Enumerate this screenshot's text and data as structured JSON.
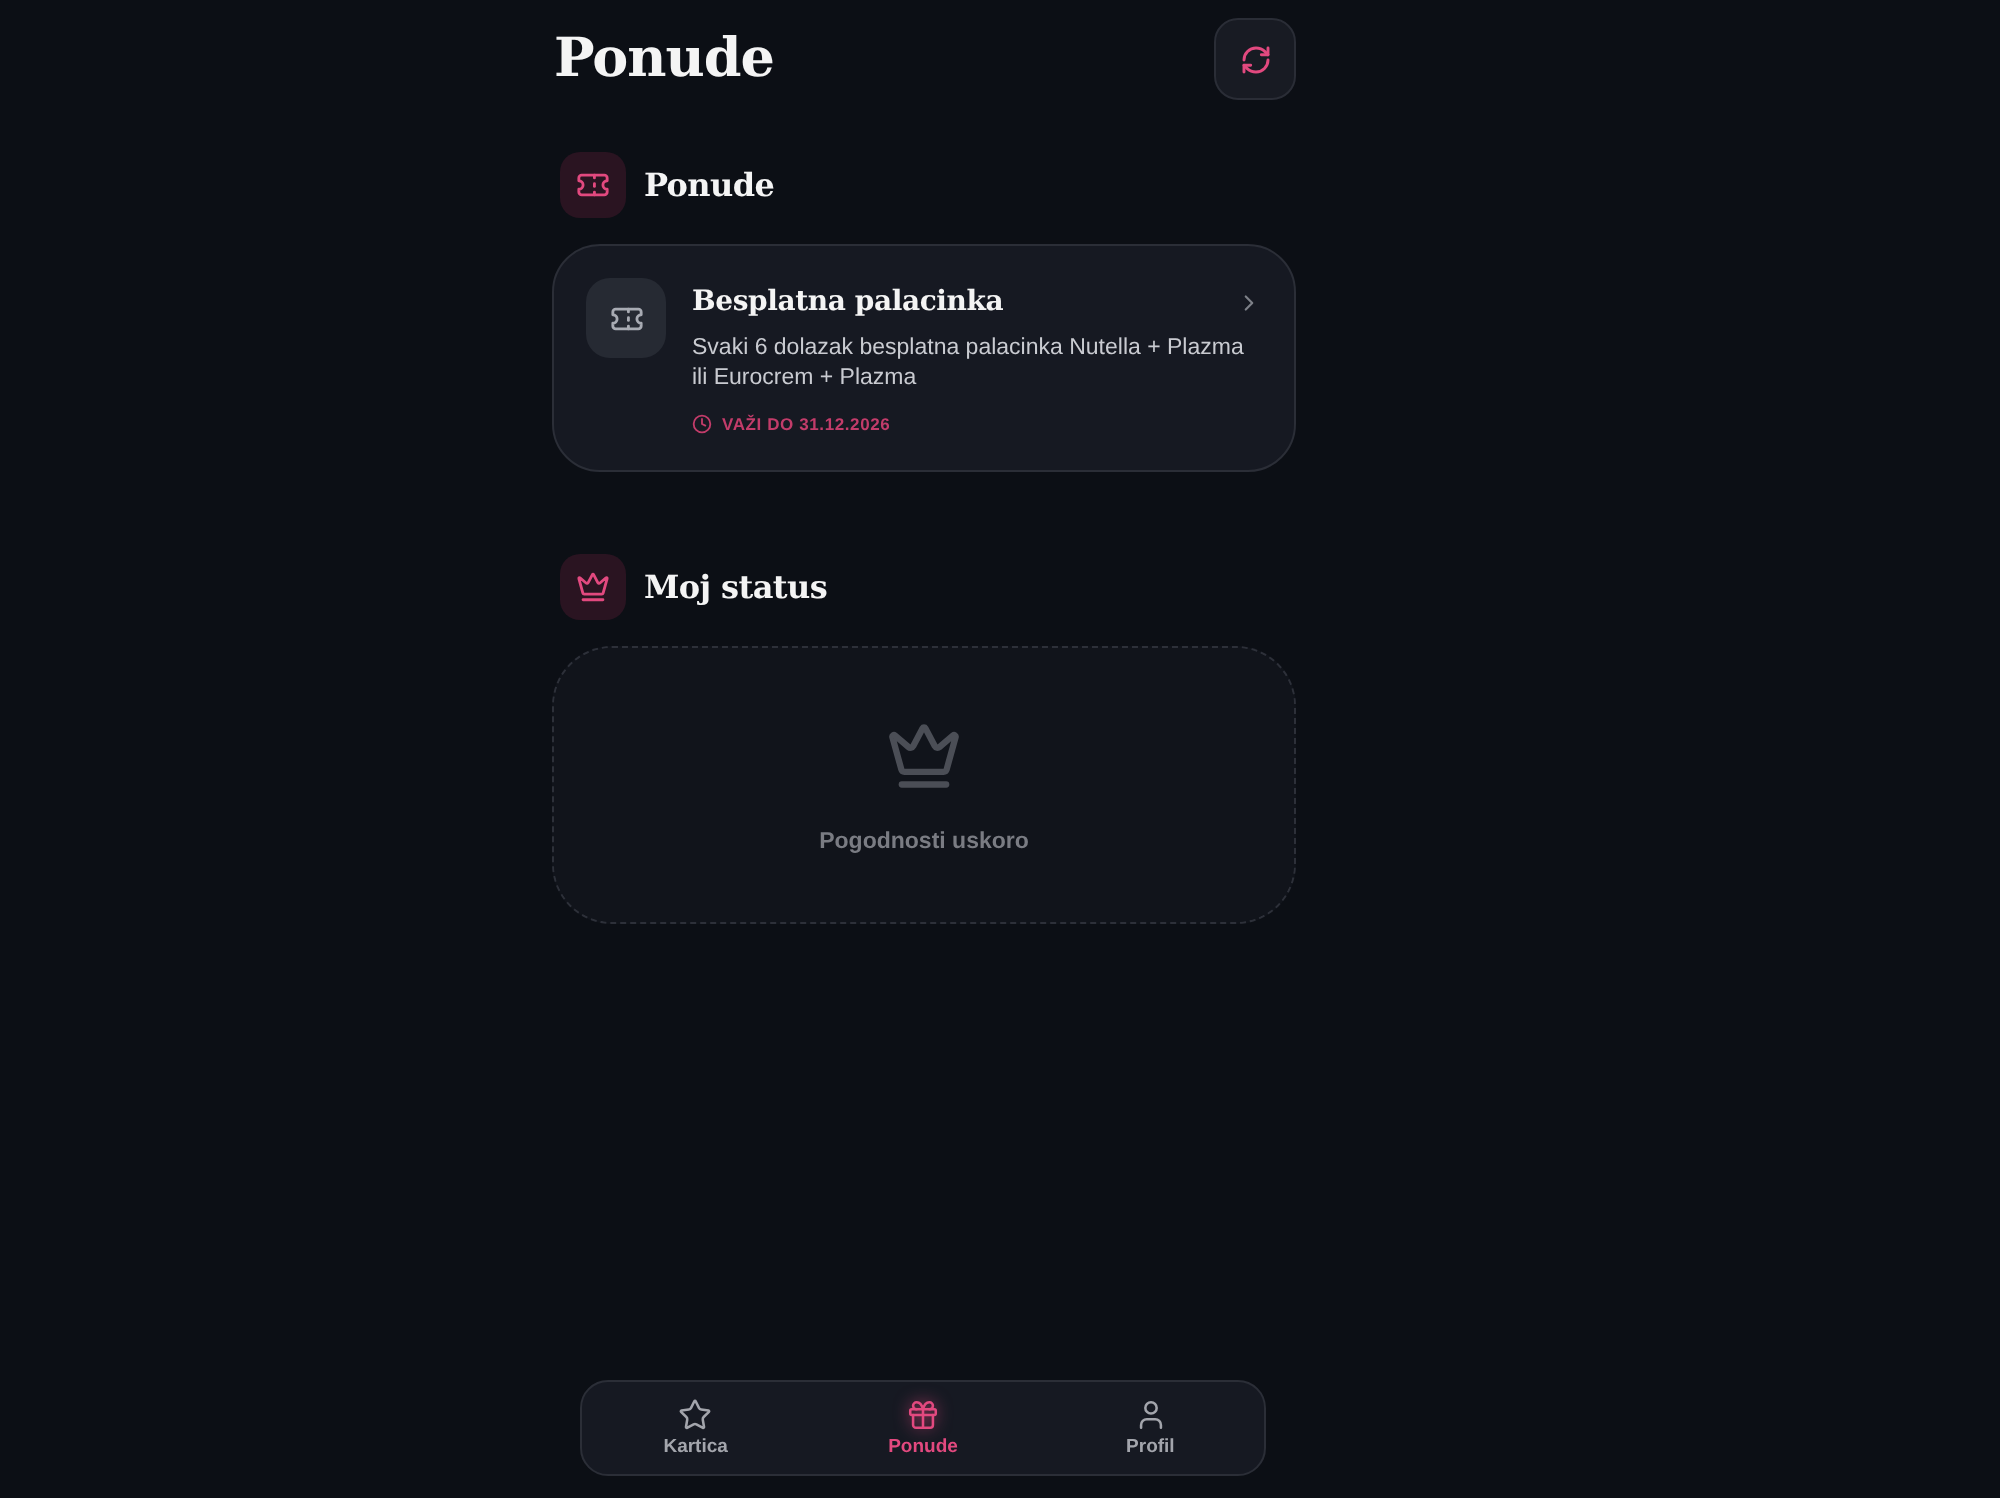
{
  "header": {
    "title": "Ponude"
  },
  "sections": [
    {
      "kind": "offers",
      "title": "Ponude",
      "offers": [
        {
          "title": "Besplatna palacinka",
          "description": "Svaki 6 dolazak besplatna palacinka Nutella + Plazma ili Eurocrem + Plazma",
          "valid_until": "VAŽI DO 31.12.2026"
        }
      ]
    },
    {
      "kind": "status",
      "title": "Moj status",
      "empty_text": "Pogodnosti uskoro"
    }
  ],
  "nav": [
    {
      "label": "Kartica",
      "selected": false
    },
    {
      "label": "Ponude",
      "selected": true
    },
    {
      "label": "Profil",
      "selected": false
    }
  ]
}
